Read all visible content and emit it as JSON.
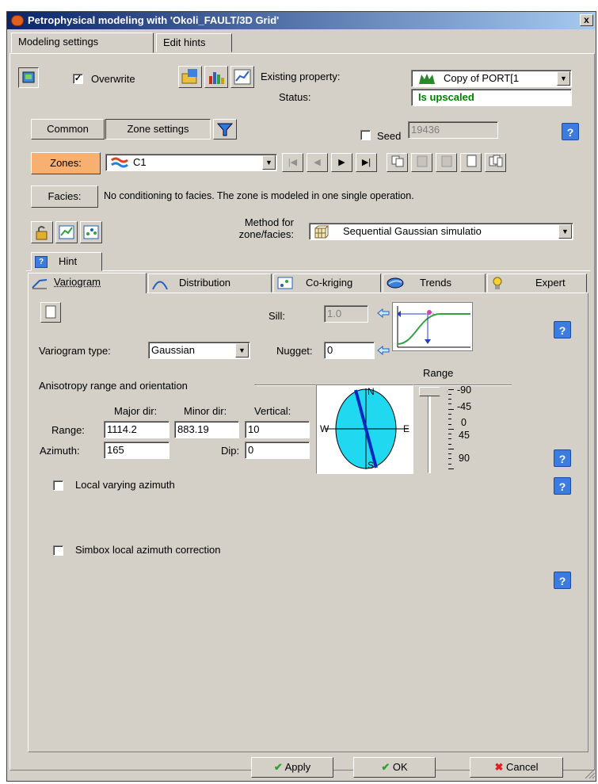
{
  "window": {
    "title": "Petrophysical modeling with 'Okoli_FAULT/3D Grid'",
    "close": "x"
  },
  "top_tabs": [
    "Modeling settings",
    "Edit hints"
  ],
  "toolbar": {
    "overwrite_label": "Overwrite",
    "overwrite_checked": "✓",
    "existing_property_label": "Existing property:",
    "existing_property_value": "Copy of PORT[1",
    "status_label": "Status:",
    "status_value": "Is upscaled",
    "status_color": "#008000"
  },
  "subtabs": [
    "Common",
    "Zone settings"
  ],
  "seed": {
    "label": "Seed",
    "value": "19436"
  },
  "zones": {
    "label": "Zones:",
    "value": "C1"
  },
  "facies": {
    "label": "Facies:",
    "text": "No conditioning to facies. The zone is modeled in one single operation."
  },
  "method": {
    "label_line1": "Method for",
    "label_line2": "zone/facies:",
    "value": "Sequential Gaussian simulatio"
  },
  "hint_tab": "Hint",
  "inner_tabs": [
    "Variogram",
    "Distribution",
    "Co-kriging",
    "Trends",
    "Expert"
  ],
  "variogram": {
    "sill_label": "Sill:",
    "sill_value": "1.0",
    "nugget_label": "Nugget:",
    "nugget_value": "0",
    "type_label": "Variogram type:",
    "type_value": "Gaussian"
  },
  "anisotropy": {
    "heading": "Anisotropy range and orientation",
    "range_heading": "Range",
    "major_label": "Major dir:",
    "minor_label": "Minor dir:",
    "vertical_label": "Vertical:",
    "range_label": "Range:",
    "major_value": "1114.2",
    "minor_value": "883.19",
    "vertical_value": "10",
    "azimuth_label": "Azimuth:",
    "azimuth_value": "165",
    "dip_label": "Dip:",
    "dip_value": "0",
    "compass": {
      "n": "N",
      "s": "S",
      "w": "W",
      "e": "E"
    },
    "dip_scale": [
      "-90",
      "-45",
      "0",
      "45",
      "90"
    ]
  },
  "options": {
    "local_azimuth": "Local varying azimuth",
    "simbox_correction": "Simbox local azimuth correction"
  },
  "help_glyph": "?",
  "buttons": {
    "apply": "Apply",
    "ok": "OK",
    "cancel": "Cancel"
  }
}
